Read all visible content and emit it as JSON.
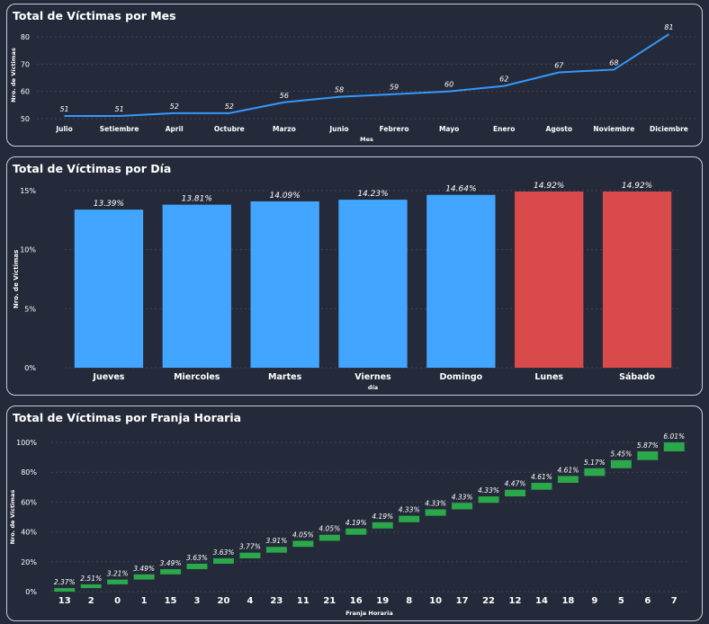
{
  "charts": [
    {
      "title": "Total de Víctimas por Mes"
    },
    {
      "title": "Total de Víctimas por Día"
    },
    {
      "title": "Total de Víctimas por Franja Horaria"
    }
  ],
  "colors": {
    "background": "#252a3a",
    "grid": "#3d4457",
    "line": "#3399ff",
    "bar_blue": "#42a5ff",
    "bar_red": "#d94b4b",
    "waterfall_green": "#2aa84a"
  },
  "chart_data": [
    {
      "type": "line",
      "title": "Total de Víctimas por Mes",
      "xlabel": "Mes",
      "ylabel": "Nro. de Víctimas",
      "categories": [
        "Julio",
        "Setiembre",
        "April",
        "Octubre",
        "Marzo",
        "Junio",
        "Febrero",
        "Mayo",
        "Enero",
        "Agosto",
        "Noviembre",
        "Diciembre"
      ],
      "values": [
        51,
        51,
        52,
        52,
        56,
        58,
        59,
        60,
        62,
        67,
        68,
        81
      ],
      "data_labels": [
        "51",
        "51",
        "52",
        "52",
        "56",
        "58",
        "59",
        "60",
        "62",
        "67",
        "68",
        "81"
      ],
      "y_ticks": [
        "50",
        "60",
        "70",
        "80"
      ],
      "y_tick_values": [
        50,
        60,
        70,
        80
      ],
      "ylim": [
        49,
        83
      ],
      "grid": true
    },
    {
      "type": "bar",
      "title": "Total de Víctimas por Día",
      "xlabel": "día",
      "ylabel": "Nro. de Víctimas",
      "categories": [
        "Jueves",
        "Miercoles",
        "Martes",
        "Viernes",
        "Domingo",
        "Lunes",
        "Sábado"
      ],
      "values": [
        13.39,
        13.81,
        14.09,
        14.23,
        14.64,
        14.92,
        14.92
      ],
      "data_labels": [
        "13.39%",
        "13.81%",
        "14.09%",
        "14.23%",
        "14.64%",
        "14.92%",
        "14.92%"
      ],
      "highlight": [
        false,
        false,
        false,
        false,
        false,
        true,
        true
      ],
      "y_ticks": [
        "0%",
        "5%",
        "10%",
        "15%"
      ],
      "y_tick_values": [
        0,
        5,
        10,
        15
      ],
      "ylim": [
        0,
        15
      ],
      "grid": true
    },
    {
      "type": "bar",
      "subtype": "waterfall",
      "title": "Total de Víctimas por Franja Horaria",
      "xlabel": "Franja Horaria",
      "ylabel": "Nro. de Víctimas",
      "categories": [
        "13",
        "2",
        "0",
        "1",
        "15",
        "3",
        "20",
        "4",
        "23",
        "11",
        "21",
        "16",
        "19",
        "8",
        "10",
        "17",
        "22",
        "12",
        "14",
        "18",
        "9",
        "5",
        "6",
        "7"
      ],
      "values": [
        2.37,
        2.51,
        3.21,
        3.49,
        3.49,
        3.63,
        3.63,
        3.77,
        3.91,
        4.05,
        4.05,
        4.19,
        4.19,
        4.33,
        4.33,
        4.33,
        4.33,
        4.47,
        4.61,
        4.61,
        5.17,
        5.45,
        5.87,
        6.01
      ],
      "data_labels": [
        "2.37%",
        "2.51%",
        "3.21%",
        "3.49%",
        "3.49%",
        "3.63%",
        "3.63%",
        "3.77%",
        "3.91%",
        "4.05%",
        "4.05%",
        "4.19%",
        "4.19%",
        "4.33%",
        "4.33%",
        "4.33%",
        "4.33%",
        "4.47%",
        "4.61%",
        "4.61%",
        "5.17%",
        "5.45%",
        "5.87%",
        "6.01%"
      ],
      "y_ticks": [
        "0%",
        "20%",
        "40%",
        "60%",
        "80%",
        "100%"
      ],
      "y_tick_values": [
        0,
        20,
        40,
        60,
        80,
        100
      ],
      "ylim": [
        0,
        100
      ],
      "grid": true
    }
  ]
}
